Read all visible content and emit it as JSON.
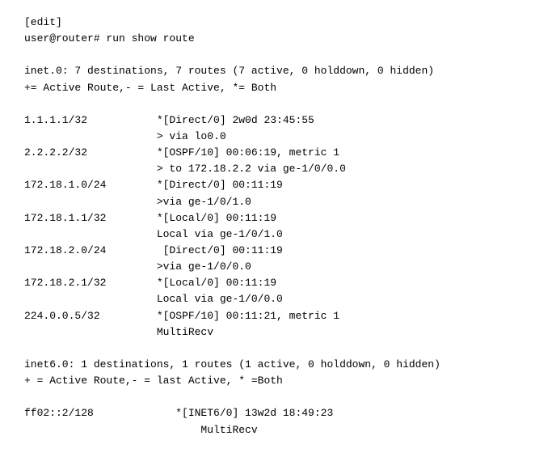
{
  "header": {
    "edit": "[edit]",
    "prompt": "user@router# run show route"
  },
  "inet4": {
    "summary": "inet.0: 7 destinations, 7 routes (7 active, 0 holddown, 0 hidden)",
    "legend": "+= Active Route,- = Last Active, *= Both",
    "entries": [
      {
        "dest": "1.1.1.1/32",
        "col2": "*[Direct/0] 2w0d 23:45:55"
      },
      {
        "dest": "",
        "col2": "> via lo0.0"
      },
      {
        "dest": "2.2.2.2/32",
        "col2": "*[OSPF/10] 00:06:19, metric 1"
      },
      {
        "dest": "",
        "col2": "> to 172.18.2.2 via ge-1/0/0.0"
      },
      {
        "dest": "172.18.1.0/24",
        "col2": "*[Direct/0] 00:11:19"
      },
      {
        "dest": "",
        "col2": ">via ge-1/0/1.0"
      },
      {
        "dest": "172.18.1.1/32",
        "col2": "*[Local/0] 00:11:19"
      },
      {
        "dest": "",
        "col2": "Local via ge-1/0/1.0"
      },
      {
        "dest": "172.18.2.0/24",
        "col2": " [Direct/0] 00:11:19"
      },
      {
        "dest": "",
        "col2": ">via ge-1/0/0.0"
      },
      {
        "dest": "172.18.2.1/32",
        "col2": "*[Local/0] 00:11:19"
      },
      {
        "dest": "",
        "col2": "Local via ge-1/0/0.0"
      },
      {
        "dest": "224.0.0.5/32",
        "col2": "*[OSPF/10] 00:11:21, metric 1"
      },
      {
        "dest": "",
        "col2": "MultiRecv"
      }
    ]
  },
  "inet6": {
    "summary": "inet6.0: 1 destinations, 1 routes (1 active, 0 holddown, 0 hidden)",
    "legend": "+ = Active Route,- = last Active, * =Both",
    "entries": [
      {
        "dest": "ff02::2/128",
        "col2": " *[INET6/0] 13w2d 18:49:23"
      },
      {
        "dest": "",
        "col2": "     MultiRecv"
      }
    ]
  }
}
